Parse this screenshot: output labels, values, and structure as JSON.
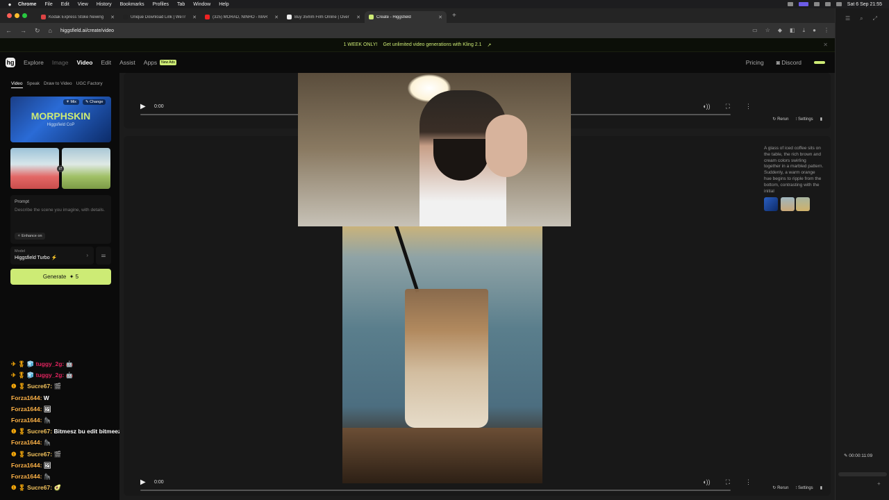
{
  "mac": {
    "apple": "",
    "menus": [
      "Chrome",
      "File",
      "Edit",
      "View",
      "History",
      "Bookmarks",
      "Profiles",
      "Tab",
      "Window",
      "Help"
    ],
    "clock": "Sat 6 Sep  21:55"
  },
  "tabs": [
    {
      "label": "Kodak Express Stoke Newing",
      "fav": "#d44",
      "active": false
    },
    {
      "label": "Unique Download Link | WeTr",
      "fav": "#222",
      "active": false
    },
    {
      "label": "(325) MORAD, NINHO - MAR",
      "fav": "#e22",
      "active": false
    },
    {
      "label": "Buy 35mm Film Online | Over",
      "fav": "#eee",
      "active": false
    },
    {
      "label": "Create - Higgsfield",
      "fav": "#cdeb75",
      "active": true
    }
  ],
  "address": {
    "url": "higgsfield.ai/create/video"
  },
  "promo": {
    "badge": "1 WEEK ONLY!",
    "text": "Get unlimited video generations with Kling 2.1",
    "arrow": "↗",
    "close": "✕"
  },
  "appnav": {
    "logo": "hg",
    "items": [
      "Explore",
      "Image",
      "Video",
      "Edit",
      "Assist",
      "Apps"
    ],
    "badge": "New Ads",
    "pricing": "Pricing",
    "discord": "Discord"
  },
  "left": {
    "subtabs": [
      "Video",
      "Speak",
      "Draw to Video",
      "UGC Factory"
    ],
    "hero": {
      "title": "MORPHSKIN",
      "subtitle": "Higgsfield CoP",
      "mix": "Mix",
      "change": "Change"
    },
    "prompt": {
      "label": "Prompt",
      "placeholder": "Describe the scene you imagine, with details.",
      "enhance": "Enhance on"
    },
    "model": {
      "label": "Model",
      "value": "Higgsfield Turbo ⚡"
    },
    "generate": {
      "label": "Generate",
      "cost": "✦ 5"
    }
  },
  "chat": [
    {
      "icons": "✈ 🎖 🧊",
      "user": "tuggy_2g:",
      "ucls": "u-red",
      "msg": "🤖"
    },
    {
      "icons": "✈ 🎖 🧊",
      "user": "tuggy_2g:",
      "ucls": "u-red",
      "msg": "🤖"
    },
    {
      "icons": "❶ 🎖",
      "user": "Sucre67:",
      "ucls": "u-gold",
      "msg": "🎬"
    },
    {
      "icons": "",
      "user": "Forza1644:",
      "ucls": "u-orange",
      "msg": "W"
    },
    {
      "icons": "",
      "user": "Forza1644:",
      "ucls": "u-orange",
      "msg": "🖼"
    },
    {
      "icons": "",
      "user": "Forza1644:",
      "ucls": "u-orange",
      "msg": "🦍"
    },
    {
      "icons": "❶ 🎖",
      "user": "Sucre67:",
      "ucls": "u-gold",
      "msg": "Bitmesz bu edit bitmeez"
    },
    {
      "icons": "",
      "user": "Forza1644:",
      "ucls": "u-orange",
      "msg": "🦍"
    },
    {
      "icons": "❶ 🎖",
      "user": "Sucre67:",
      "ucls": "u-gold",
      "msg": "🎬"
    },
    {
      "icons": "",
      "user": "Forza1644:",
      "ucls": "u-orange",
      "msg": "🖼"
    },
    {
      "icons": "",
      "user": "Forza1644:",
      "ucls": "u-orange",
      "msg": "🦍"
    },
    {
      "icons": "❶ 🎖",
      "user": "Sucre67:",
      "ucls": "u-gold",
      "msg": "🥑"
    }
  ],
  "video1": {
    "time": "0:00",
    "rerun": "Rerun",
    "settings": "Settings"
  },
  "video2": {
    "time": "0:00",
    "rerun": "Rerun",
    "settings": "Settings",
    "description": "A glass of iced coffee sits on the table, the rich brown and cream colors swirling together in a marbled pattern. Suddenly, a warm orange hue begins to ripple from the bottom, contrasting with the initial"
  },
  "rpanel": {
    "timecode": "00:00:11:09"
  }
}
